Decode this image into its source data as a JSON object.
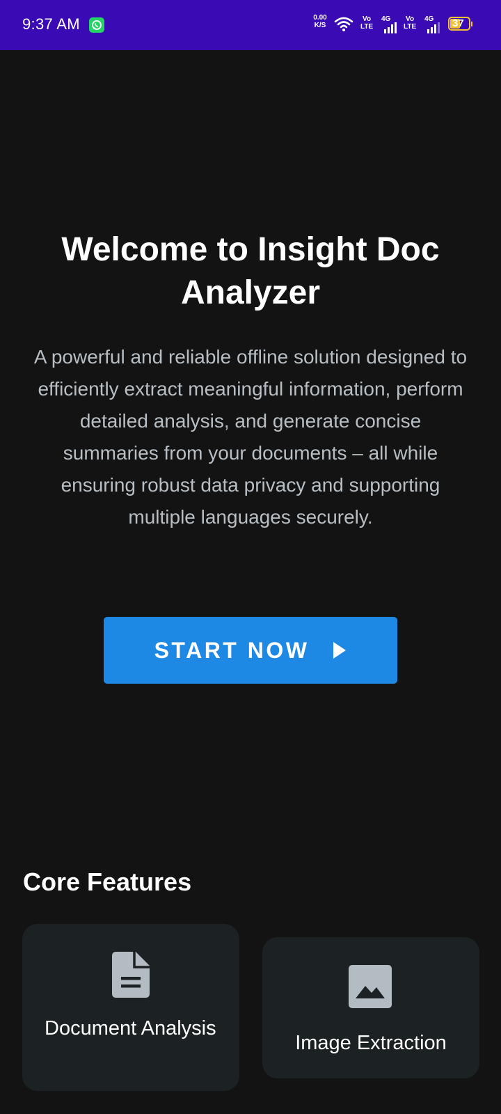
{
  "status_bar": {
    "time": "9:37 AM",
    "net_speed_value": "0.00",
    "net_speed_unit": "K/S",
    "sim1_volte_top": "Vo",
    "sim1_volte_bottom": "LTE",
    "sim1_network": "4G",
    "sim2_volte_top": "Vo",
    "sim2_volte_bottom": "LTE",
    "sim2_network": "4G",
    "battery_level": "37"
  },
  "hero": {
    "title": "Welcome to Insight Doc Analyzer",
    "description": "A powerful and reliable offline solution designed to efficiently extract meaningful information, perform detailed analysis, and generate concise summaries from your documents – all while ensuring robust data privacy and supporting multiple languages securely.",
    "start_button_label": "START NOW"
  },
  "features": {
    "section_title": "Core Features",
    "items": [
      {
        "label": "Document Analysis",
        "icon": "document-icon"
      },
      {
        "label": "Image Extraction",
        "icon": "image-icon"
      }
    ]
  },
  "colors": {
    "status_bar_bg": "#3a0bb5",
    "page_bg": "#131313",
    "accent_button": "#1e88e5",
    "card_bg": "#1c2123",
    "battery": "#f2c230"
  }
}
